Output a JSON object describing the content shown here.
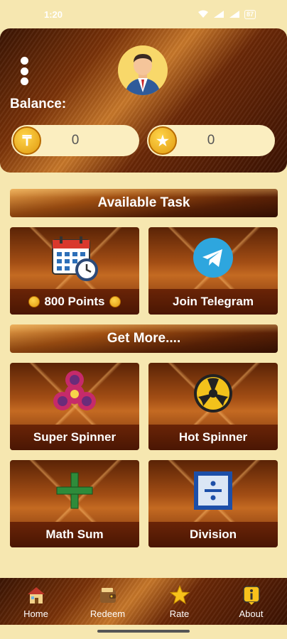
{
  "status_bar": {
    "time": "1:20",
    "battery": "87"
  },
  "header": {
    "balance_label": "Balance:",
    "currency_balance": "0",
    "coin_balance": "0"
  },
  "sections": {
    "available_task": "Available Task",
    "get_more": "Get More...."
  },
  "tasks": [
    {
      "label": "800 Points",
      "icon": "calendar-clock-icon"
    },
    {
      "label": "Join Telegram",
      "icon": "telegram-icon"
    }
  ],
  "more": [
    {
      "label": "Super Spinner",
      "icon": "fidget-spinner-icon"
    },
    {
      "label": "Hot Spinner",
      "icon": "yellow-spinner-icon"
    },
    {
      "label": "Math Sum",
      "icon": "plus-icon"
    },
    {
      "label": "Division",
      "icon": "division-icon"
    }
  ],
  "bottom_nav": [
    {
      "label": "Home",
      "icon": "house-icon"
    },
    {
      "label": "Redeem",
      "icon": "wallet-icon"
    },
    {
      "label": "Rate",
      "icon": "star-icon"
    },
    {
      "label": "About",
      "icon": "info-icon"
    }
  ],
  "colors": {
    "background": "#f6e7b0",
    "wood_dark": "#3b1202",
    "wood_light": "#c8782a",
    "coin": "#f2b51c"
  }
}
